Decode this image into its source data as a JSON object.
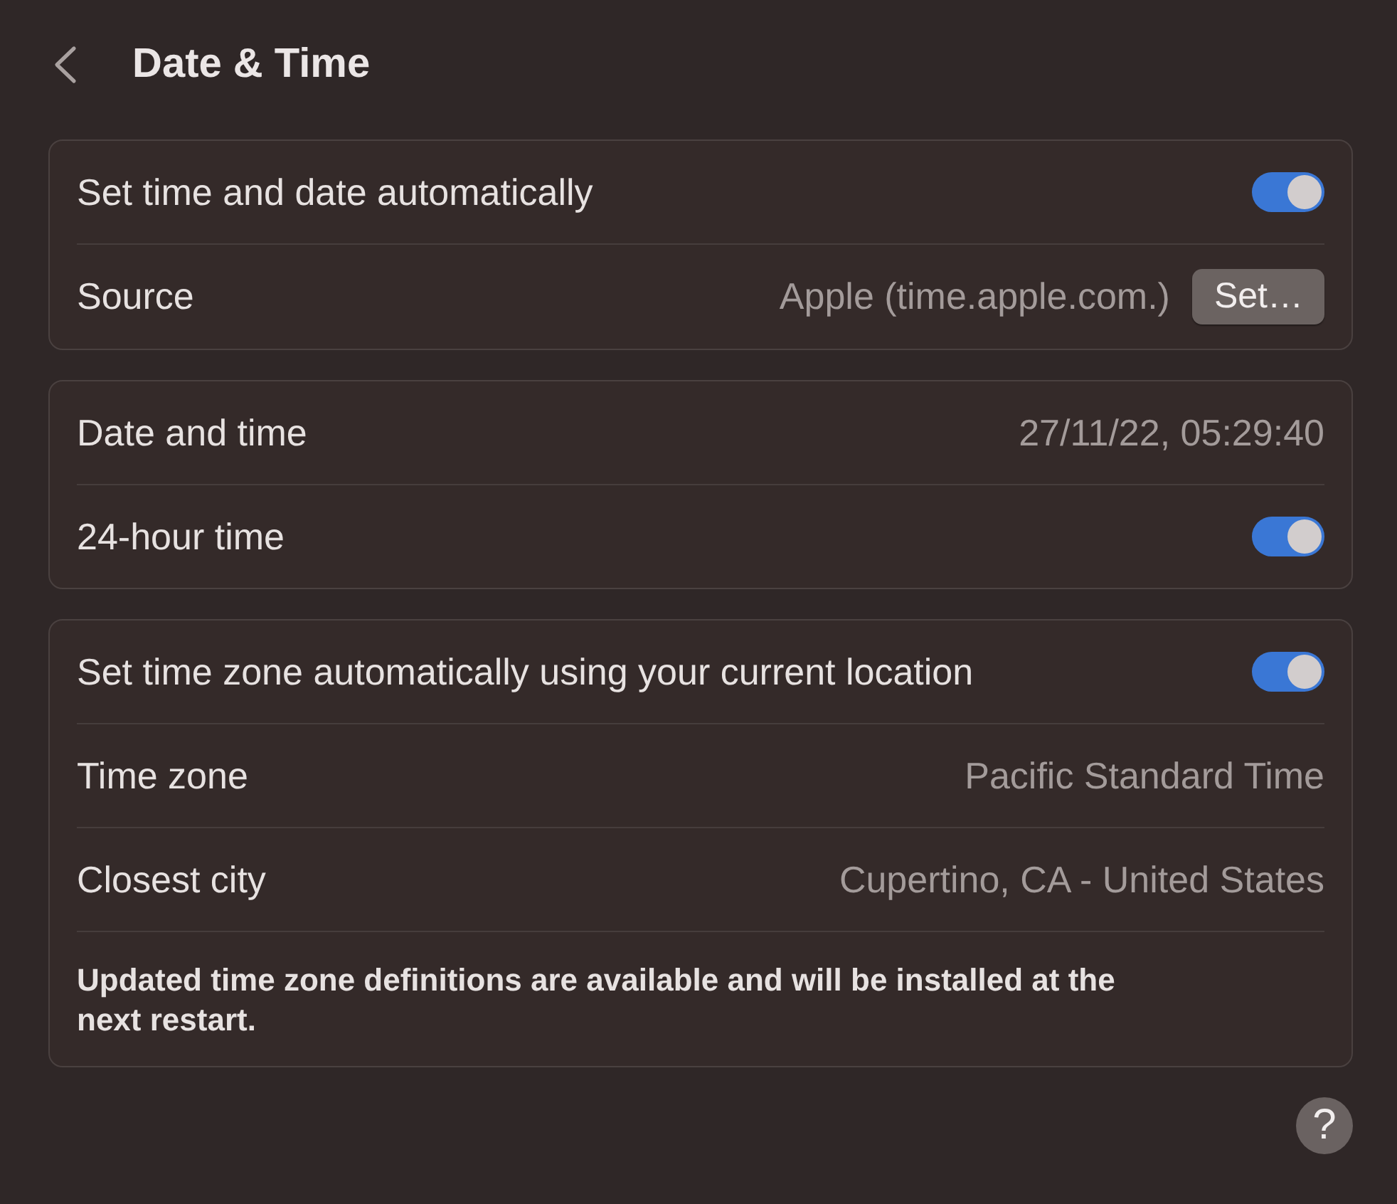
{
  "header": {
    "title": "Date & Time"
  },
  "sections": [
    {
      "rows": [
        {
          "kind": "toggle",
          "label": "Set time and date automatically",
          "on": true
        },
        {
          "kind": "button",
          "label": "Source",
          "value": "Apple (time.apple.com.)",
          "button": "Set…"
        }
      ]
    },
    {
      "rows": [
        {
          "kind": "value",
          "label": "Date and time",
          "value": "27/11/22, 05:29:40"
        },
        {
          "kind": "toggle",
          "label": "24-hour time",
          "on": true
        }
      ]
    },
    {
      "rows": [
        {
          "kind": "toggle",
          "label": "Set time zone automatically using your current location",
          "on": true
        },
        {
          "kind": "value",
          "label": "Time zone",
          "value": "Pacific Standard Time"
        },
        {
          "kind": "value",
          "label": "Closest city",
          "value": "Cupertino, CA - United States"
        },
        {
          "kind": "note",
          "text": "Updated time zone definitions are available and will be installed at the next restart."
        }
      ]
    }
  ],
  "help_button": {
    "label": "?"
  }
}
